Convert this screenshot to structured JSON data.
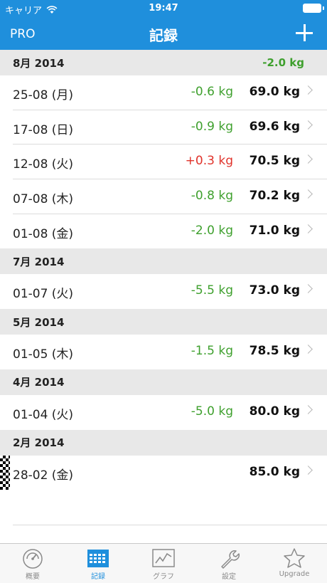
{
  "status_bar": {
    "carrier": "キャリア",
    "time": "19:47"
  },
  "nav": {
    "left_label": "PRO",
    "title": "記録"
  },
  "colors": {
    "accent": "#1f8fdc",
    "gain": "#e0332b",
    "loss": "#3fa02e"
  },
  "sections": [
    {
      "title": "8月 2014",
      "delta": "-2.0 kg",
      "rows": [
        {
          "date": "25-08 (月)",
          "delta": "-0.6 kg",
          "weight": "69.0 kg"
        },
        {
          "date": "17-08 (日)",
          "delta": "-0.9 kg",
          "weight": "69.6 kg"
        },
        {
          "date": "12-08 (火)",
          "delta": "+0.3 kg",
          "weight": "70.5 kg"
        },
        {
          "date": "07-08 (木)",
          "delta": "-0.8 kg",
          "weight": "70.2 kg"
        },
        {
          "date": "01-08 (金)",
          "delta": "-2.0 kg",
          "weight": "71.0 kg"
        }
      ]
    },
    {
      "title": "7月 2014",
      "rows": [
        {
          "date": "01-07 (火)",
          "delta": "-5.5 kg",
          "weight": "73.0 kg"
        }
      ]
    },
    {
      "title": "5月 2014",
      "rows": [
        {
          "date": "01-05 (木)",
          "delta": "-1.5 kg",
          "weight": "78.5 kg"
        }
      ]
    },
    {
      "title": "4月 2014",
      "rows": [
        {
          "date": "01-04 (火)",
          "delta": "-5.0 kg",
          "weight": "80.0 kg"
        }
      ]
    },
    {
      "title": "2月 2014",
      "rows": [
        {
          "date": "28-02 (金)",
          "delta": "",
          "weight": "85.0 kg"
        }
      ]
    }
  ],
  "tabs": [
    {
      "label": "概要",
      "icon": "gauge-icon"
    },
    {
      "label": "記録",
      "icon": "calendar-icon",
      "active": true
    },
    {
      "label": "グラフ",
      "icon": "graph-icon"
    },
    {
      "label": "設定",
      "icon": "wrench-icon"
    },
    {
      "label": "Upgrade",
      "icon": "star-icon"
    }
  ]
}
